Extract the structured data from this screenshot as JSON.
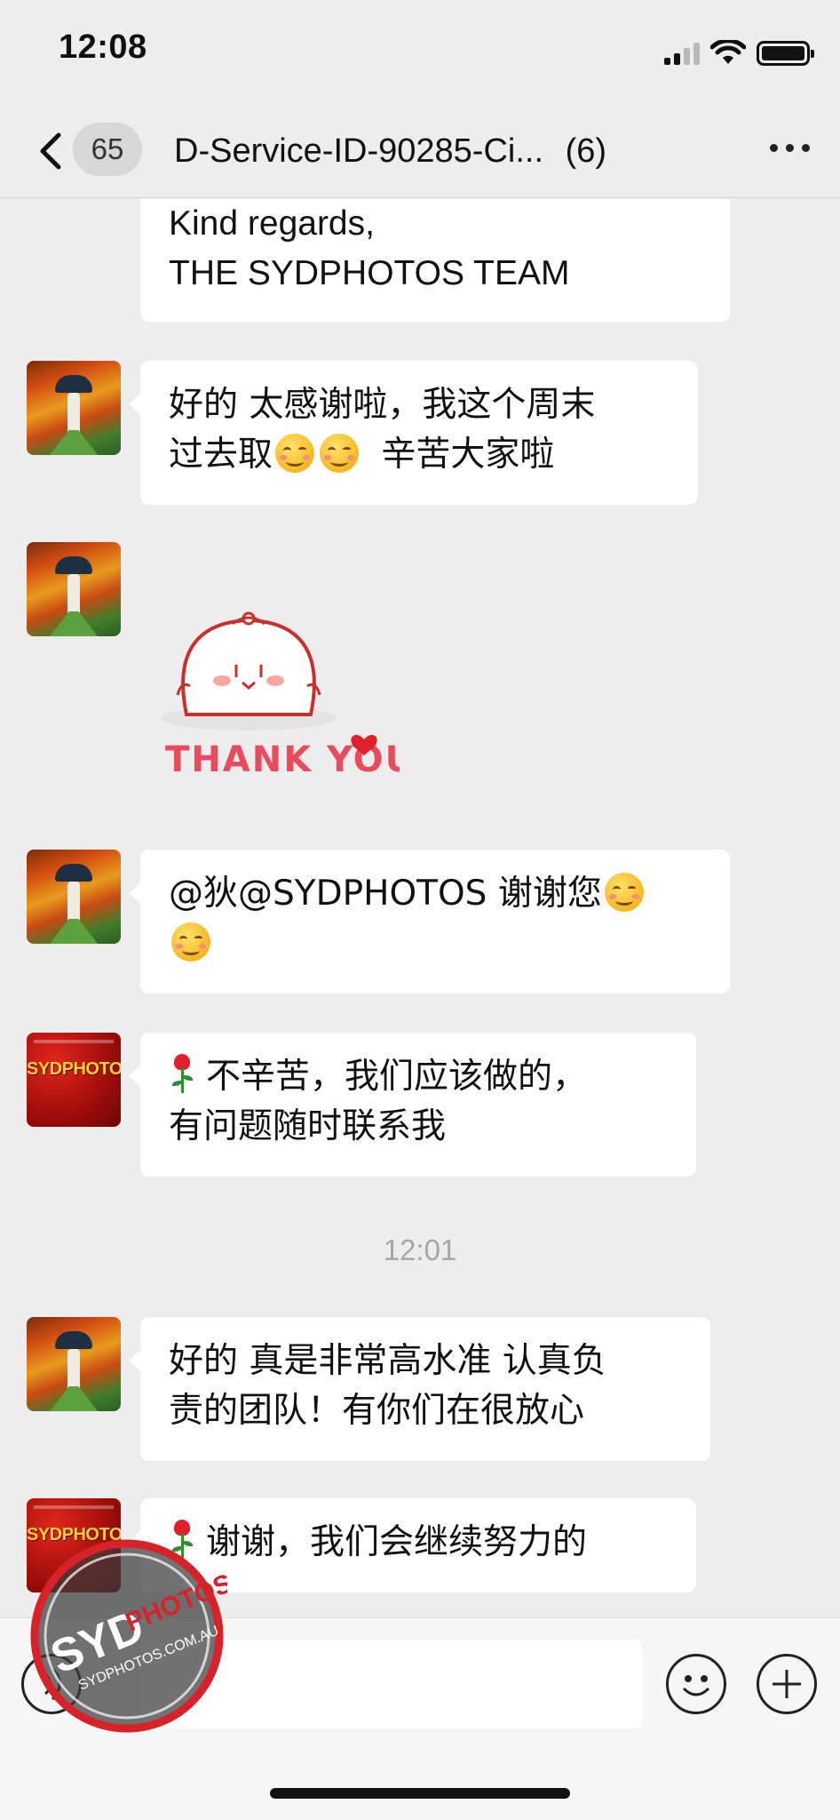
{
  "status_bar": {
    "time": "12:08"
  },
  "header": {
    "unread_count": "65",
    "title": "D-Service-ID-90285-Ci...",
    "member_count": "(6)"
  },
  "messages": [
    {
      "sender": "sydphotos",
      "lines": [
        "Kind regards,",
        "THE SYDPHOTOS TEAM"
      ]
    },
    {
      "sender": "customer",
      "text_1": "好的 太感谢啦，我这个周末",
      "text_2": "过去取",
      "text_3": "辛苦大家啦"
    },
    {
      "sender": "customer",
      "sticker_text": "THANK YOU"
    },
    {
      "sender": "customer",
      "text_1": "@狄@SYDPHOTOS 谢谢您"
    },
    {
      "sender": "sydphotos",
      "text_1": "不辛苦，我们应该做的，",
      "text_2": "有问题随时联系我"
    },
    {
      "timestamp": "12:01"
    },
    {
      "sender": "customer",
      "text_1": "好的 真是非常高水准 认真负",
      "text_2": "责的团队！有你们在很放心"
    },
    {
      "sender": "sydphotos",
      "text_1": "谢谢，我们会继续努力的"
    }
  ],
  "avatar_labels": {
    "sydphotos": "SYDPHOTOS"
  },
  "watermark": {
    "brand_syd": "SYD",
    "brand_photos": "PHOTOS",
    "url": "SYDPHOTOS.COM.AU"
  },
  "input_bar": {
    "value": ""
  },
  "colors": {
    "background": "#ededed",
    "bubble": "#ffffff",
    "timestamp": "#a6a6a6",
    "watermark_red": "#d8222a"
  },
  "icons": [
    "back-arrow-icon",
    "more-icon",
    "voice-icon",
    "emoji-icon",
    "plus-icon",
    "smile-emoji-icon",
    "rose-emoji-icon"
  ]
}
